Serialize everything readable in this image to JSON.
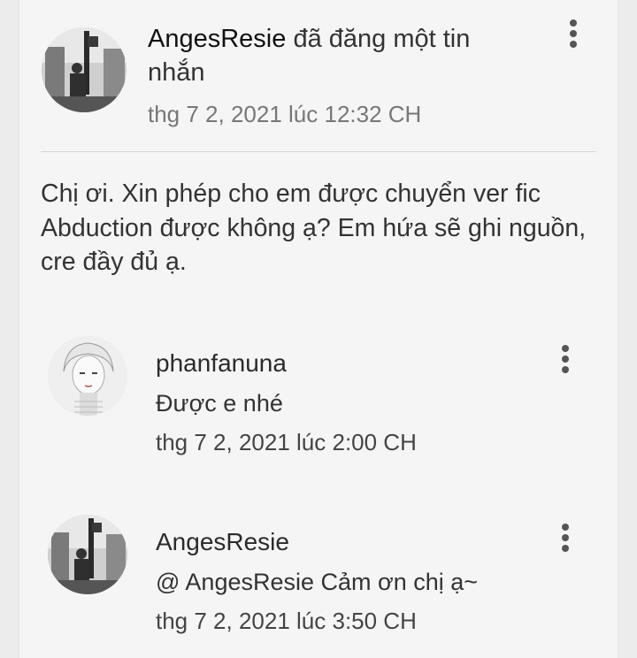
{
  "post": {
    "author": "AngesResie",
    "action": "đã đăng một tin nhắn",
    "timestamp": "thg 7 2, 2021 lúc 12:32 CH",
    "body": "Chị ơi. Xin phép cho em được chuyển ver fic Abduction được không ạ? Em hứa sẽ ghi nguồn, cre đầy đủ ạ.",
    "menu_icon": "more-vertical-icon"
  },
  "replies": [
    {
      "author": "phanfanuna",
      "text": "Được e nhé",
      "timestamp": "thg 7 2, 2021 lúc 2:00 CH",
      "menu_icon": "more-vertical-icon"
    },
    {
      "author": "AngesResie",
      "text": "@ AngesResie  Cảm ơn chị ạ~",
      "timestamp": "thg 7 2, 2021 lúc 3:50 CH",
      "menu_icon": "more-vertical-icon"
    }
  ],
  "colors": {
    "background": "#f5f5f5",
    "text": "#333333",
    "muted": "#777777",
    "divider": "#d6d6d6"
  }
}
